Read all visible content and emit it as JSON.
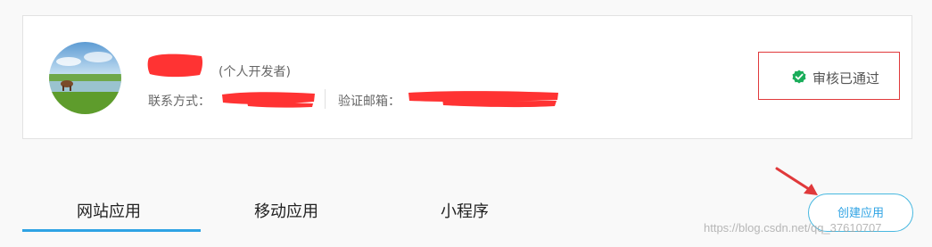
{
  "profile": {
    "account_type": "(个人开发者)",
    "contact_label": "联系方式：",
    "email_label": "验证邮箱：",
    "verify_status": "审核已通过"
  },
  "tabs": [
    {
      "label": "网站应用",
      "active": true
    },
    {
      "label": "移动应用",
      "active": false
    },
    {
      "label": "小程序",
      "active": false
    }
  ],
  "actions": {
    "create_label": "创建应用"
  },
  "watermark": "https://blog.csdn.net/qq_37610707",
  "colors": {
    "accent": "#2fa3e4",
    "verified_green": "#1aad5a",
    "annotation_red": "#e0393b"
  }
}
